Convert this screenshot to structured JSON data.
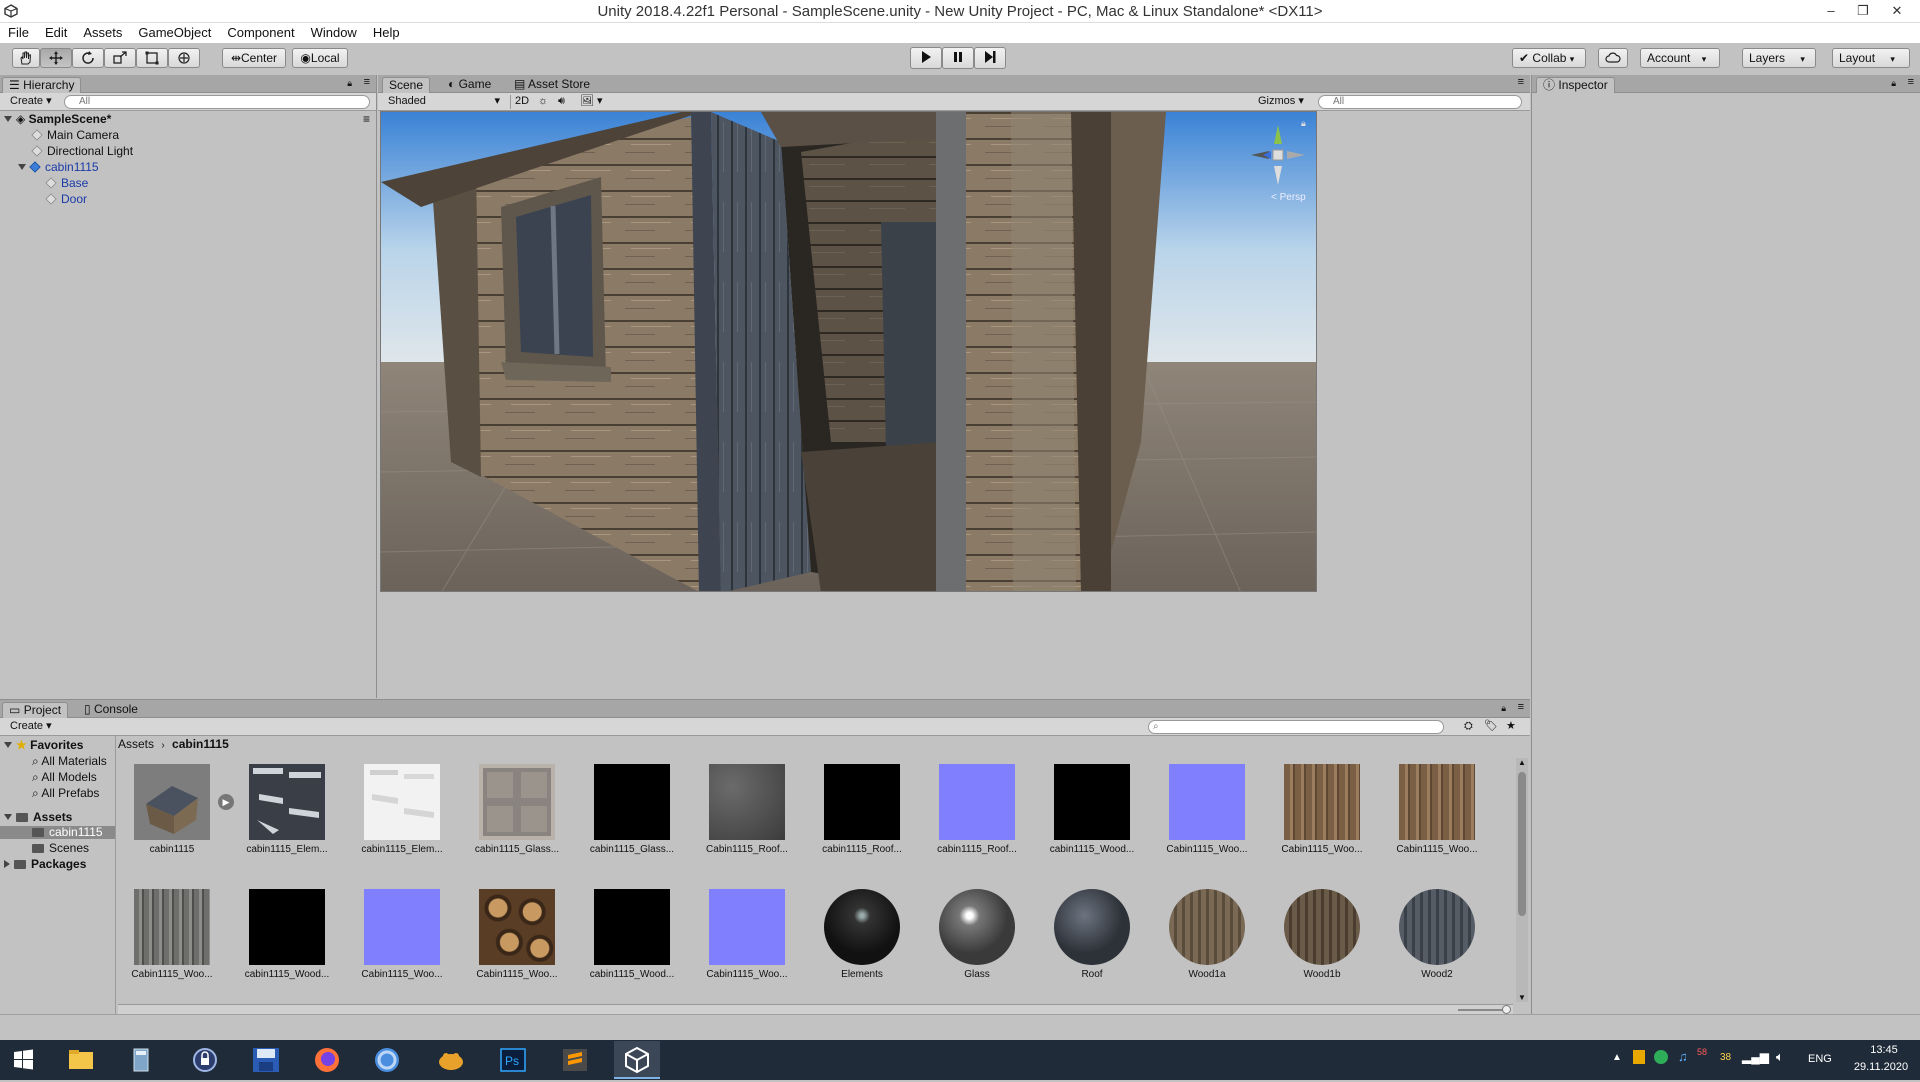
{
  "window": {
    "title": "Unity 2018.4.22f1 Personal - SampleScene.unity - New Unity Project - PC, Mac & Linux Standalone* <DX11>",
    "controls": [
      "–",
      "❐",
      "✕"
    ]
  },
  "menu": [
    "File",
    "Edit",
    "Assets",
    "GameObject",
    "Component",
    "Window",
    "Help"
  ],
  "toolbar": {
    "tools": [
      "hand-tool-icon",
      "move-tool-icon",
      "rotate-tool-icon",
      "scale-tool-icon",
      "rect-tool-icon",
      "transform-tool-icon"
    ],
    "pivot_label": "Center",
    "space_label": "Local",
    "collab_label": "Collab",
    "account_label": "Account",
    "layers_label": "Layers",
    "layout_label": "Layout"
  },
  "hierarchy": {
    "tab": "Hierarchy",
    "create_label": "Create",
    "search_placeholder": "All",
    "scene_name": "SampleScene*",
    "items": [
      {
        "label": "Main Camera",
        "depth": 1
      },
      {
        "label": "Directional Light",
        "depth": 1
      },
      {
        "label": "cabin1115",
        "depth": 1,
        "expanded": true,
        "prefab": true
      },
      {
        "label": "Base",
        "depth": 2,
        "prefab": true
      },
      {
        "label": "Door",
        "depth": 2,
        "prefab": true
      }
    ]
  },
  "scene_view": {
    "tabs": [
      "Scene",
      "Game",
      "Asset Store"
    ],
    "shading_mode": "Shaded",
    "mode_2d": "2D",
    "gizmos_label": "Gizmos",
    "search_placeholder": "All",
    "persp_label": "Persp"
  },
  "inspector": {
    "tab": "Inspector"
  },
  "project": {
    "tabs": [
      "Project",
      "Console"
    ],
    "create_label": "Create",
    "breadcrumb": [
      "Assets",
      "cabin1115"
    ],
    "favorites_label": "Favorites",
    "favorites": [
      "All Materials",
      "All Models",
      "All Prefabs"
    ],
    "assets_label": "Assets",
    "asset_folders": [
      "cabin1115",
      "Scenes"
    ],
    "packages_label": "Packages",
    "grid": [
      {
        "label": "cabin1115",
        "kind": "model"
      },
      {
        "label": "cabin1115_Elem...",
        "kind": "tex-dark-parts"
      },
      {
        "label": "cabin1115_Elem...",
        "kind": "tex-light-parts"
      },
      {
        "label": "cabin1115_Glass...",
        "kind": "tex-glass"
      },
      {
        "label": "cabin1115_Glass...",
        "kind": "tex-black"
      },
      {
        "label": "Cabin1115_Roof...",
        "kind": "tex-grey"
      },
      {
        "label": "cabin1115_Roof...",
        "kind": "tex-black"
      },
      {
        "label": "cabin1115_Roof...",
        "kind": "tex-normal"
      },
      {
        "label": "cabin1115_Wood...",
        "kind": "tex-black"
      },
      {
        "label": "Cabin1115_Woo...",
        "kind": "tex-normal"
      },
      {
        "label": "Cabin1115_Woo...",
        "kind": "tex-wood"
      },
      {
        "label": "Cabin1115_Woo...",
        "kind": "tex-wood"
      },
      {
        "label": "Cabin1115_Woo...",
        "kind": "tex-wood-grey"
      },
      {
        "label": "cabin1115_Wood...",
        "kind": "tex-black"
      },
      {
        "label": "Cabin1115_Woo...",
        "kind": "tex-normal"
      },
      {
        "label": "Cabin1115_Woo...",
        "kind": "tex-logs"
      },
      {
        "label": "cabin1115_Wood...",
        "kind": "tex-black"
      },
      {
        "label": "Cabin1115_Woo...",
        "kind": "tex-normal"
      },
      {
        "label": "Elements",
        "kind": "mat-dark"
      },
      {
        "label": "Glass",
        "kind": "mat-glass"
      },
      {
        "label": "Roof",
        "kind": "mat-roof"
      },
      {
        "label": "Wood1a",
        "kind": "mat-wood"
      },
      {
        "label": "Wood1b",
        "kind": "mat-wood2"
      },
      {
        "label": "Wood2",
        "kind": "mat-wood-grey"
      }
    ]
  },
  "taskbar": {
    "apps": [
      "windows-start-icon",
      "file-explorer-icon",
      "calculator-icon",
      "keepass-icon",
      "save-disk-icon",
      "firefox-icon",
      "chrome-icon",
      "mascot-app-icon",
      "photoshop-icon",
      "sublime-icon",
      "unity-icon"
    ],
    "tray_badge_a": "58",
    "tray_badge_b": "38",
    "language": "ENG",
    "time": "13:45",
    "date": "29.11.2020"
  }
}
